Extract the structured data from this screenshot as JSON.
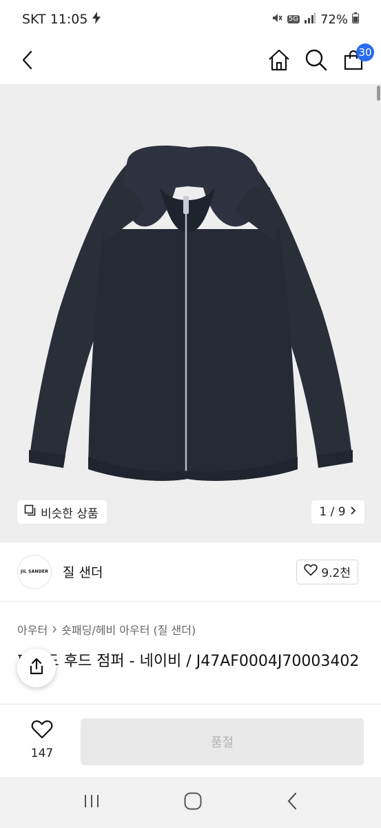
{
  "status": {
    "carrier_time": "SKT 11:05",
    "network": "5G",
    "battery": "72%"
  },
  "header": {
    "cart_count": "30",
    "icons": [
      "back-icon",
      "home-icon",
      "search-icon",
      "cart-icon"
    ]
  },
  "gallery": {
    "similar_label": "비슷한 상품",
    "pager": "1 / 9"
  },
  "brand": {
    "logo_text": "JIL SANDER",
    "name": "질 샌더",
    "likes": "9.2천"
  },
  "breadcrumb": {
    "level1": "아우터",
    "level2": "숏패딩/헤비 아우터 (질 샌더)"
  },
  "product": {
    "title": "패디드 후드 점퍼 - 네이비 / J47AF0004J70003402"
  },
  "bottom": {
    "wish_count": "147",
    "soldout_label": "품절"
  },
  "colors": {
    "accent": "#2a6cf0",
    "jacket": "#262a35"
  }
}
